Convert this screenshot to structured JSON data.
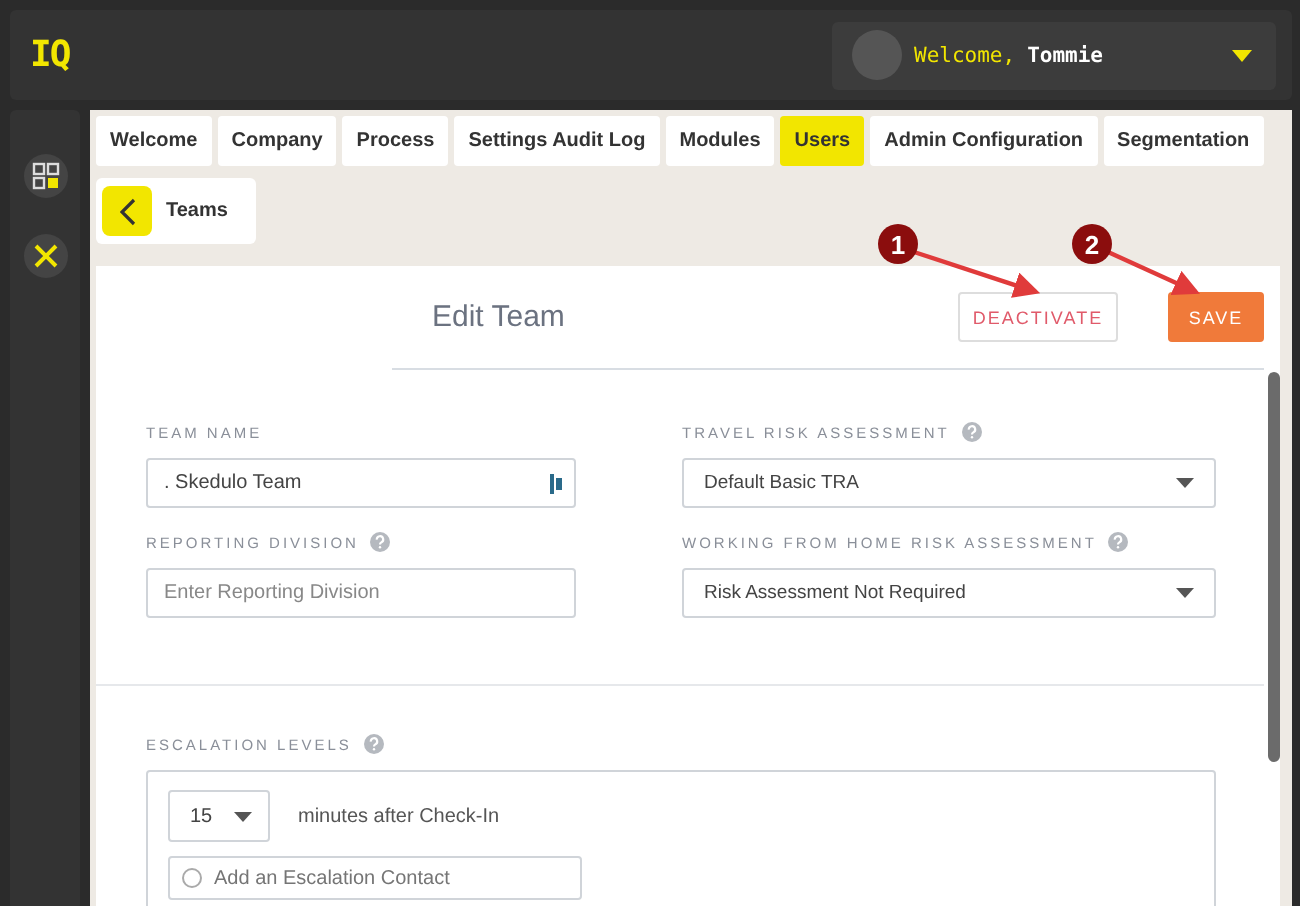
{
  "header": {
    "logo": "IQ",
    "welcome": "Welcome,",
    "user": "Tommie"
  },
  "tabs": [
    {
      "label": "Welcome",
      "selected": false
    },
    {
      "label": "Company",
      "selected": false
    },
    {
      "label": "Process",
      "selected": false
    },
    {
      "label": "Settings Audit Log",
      "selected": false
    },
    {
      "label": "Modules",
      "selected": false
    },
    {
      "label": "Users",
      "selected": true
    },
    {
      "label": "Admin Configuration",
      "selected": false
    },
    {
      "label": "Segmentation",
      "selected": false
    }
  ],
  "breadcrumb": {
    "label": "Teams"
  },
  "panel": {
    "title": "Edit Team",
    "buttons": [
      {
        "label": "DEACTIVATE",
        "kind": "outline"
      },
      {
        "label": "SAVE",
        "kind": "primary"
      }
    ]
  },
  "fields": [
    {
      "label": "TEAM NAME",
      "kind": "text",
      "value": ". Skedulo Team",
      "help": false
    },
    {
      "label": "TRAVEL RISK ASSESSMENT",
      "kind": "select",
      "value": "Default Basic TRA",
      "help": true
    },
    {
      "label": "REPORTING DIVISION",
      "kind": "text",
      "placeholder": "Enter Reporting Division",
      "help": true
    },
    {
      "label": "WORKING FROM HOME RISK ASSESSMENT",
      "kind": "select",
      "value": "Risk Assessment Not Required",
      "help": true
    }
  ],
  "escalation": {
    "label": "ESCALATION LEVELS",
    "minutes": "15",
    "after": "minutes after Check-In",
    "contact_placeholder": "Add an Escalation Contact"
  },
  "annotations": [
    "1",
    "2"
  ]
}
